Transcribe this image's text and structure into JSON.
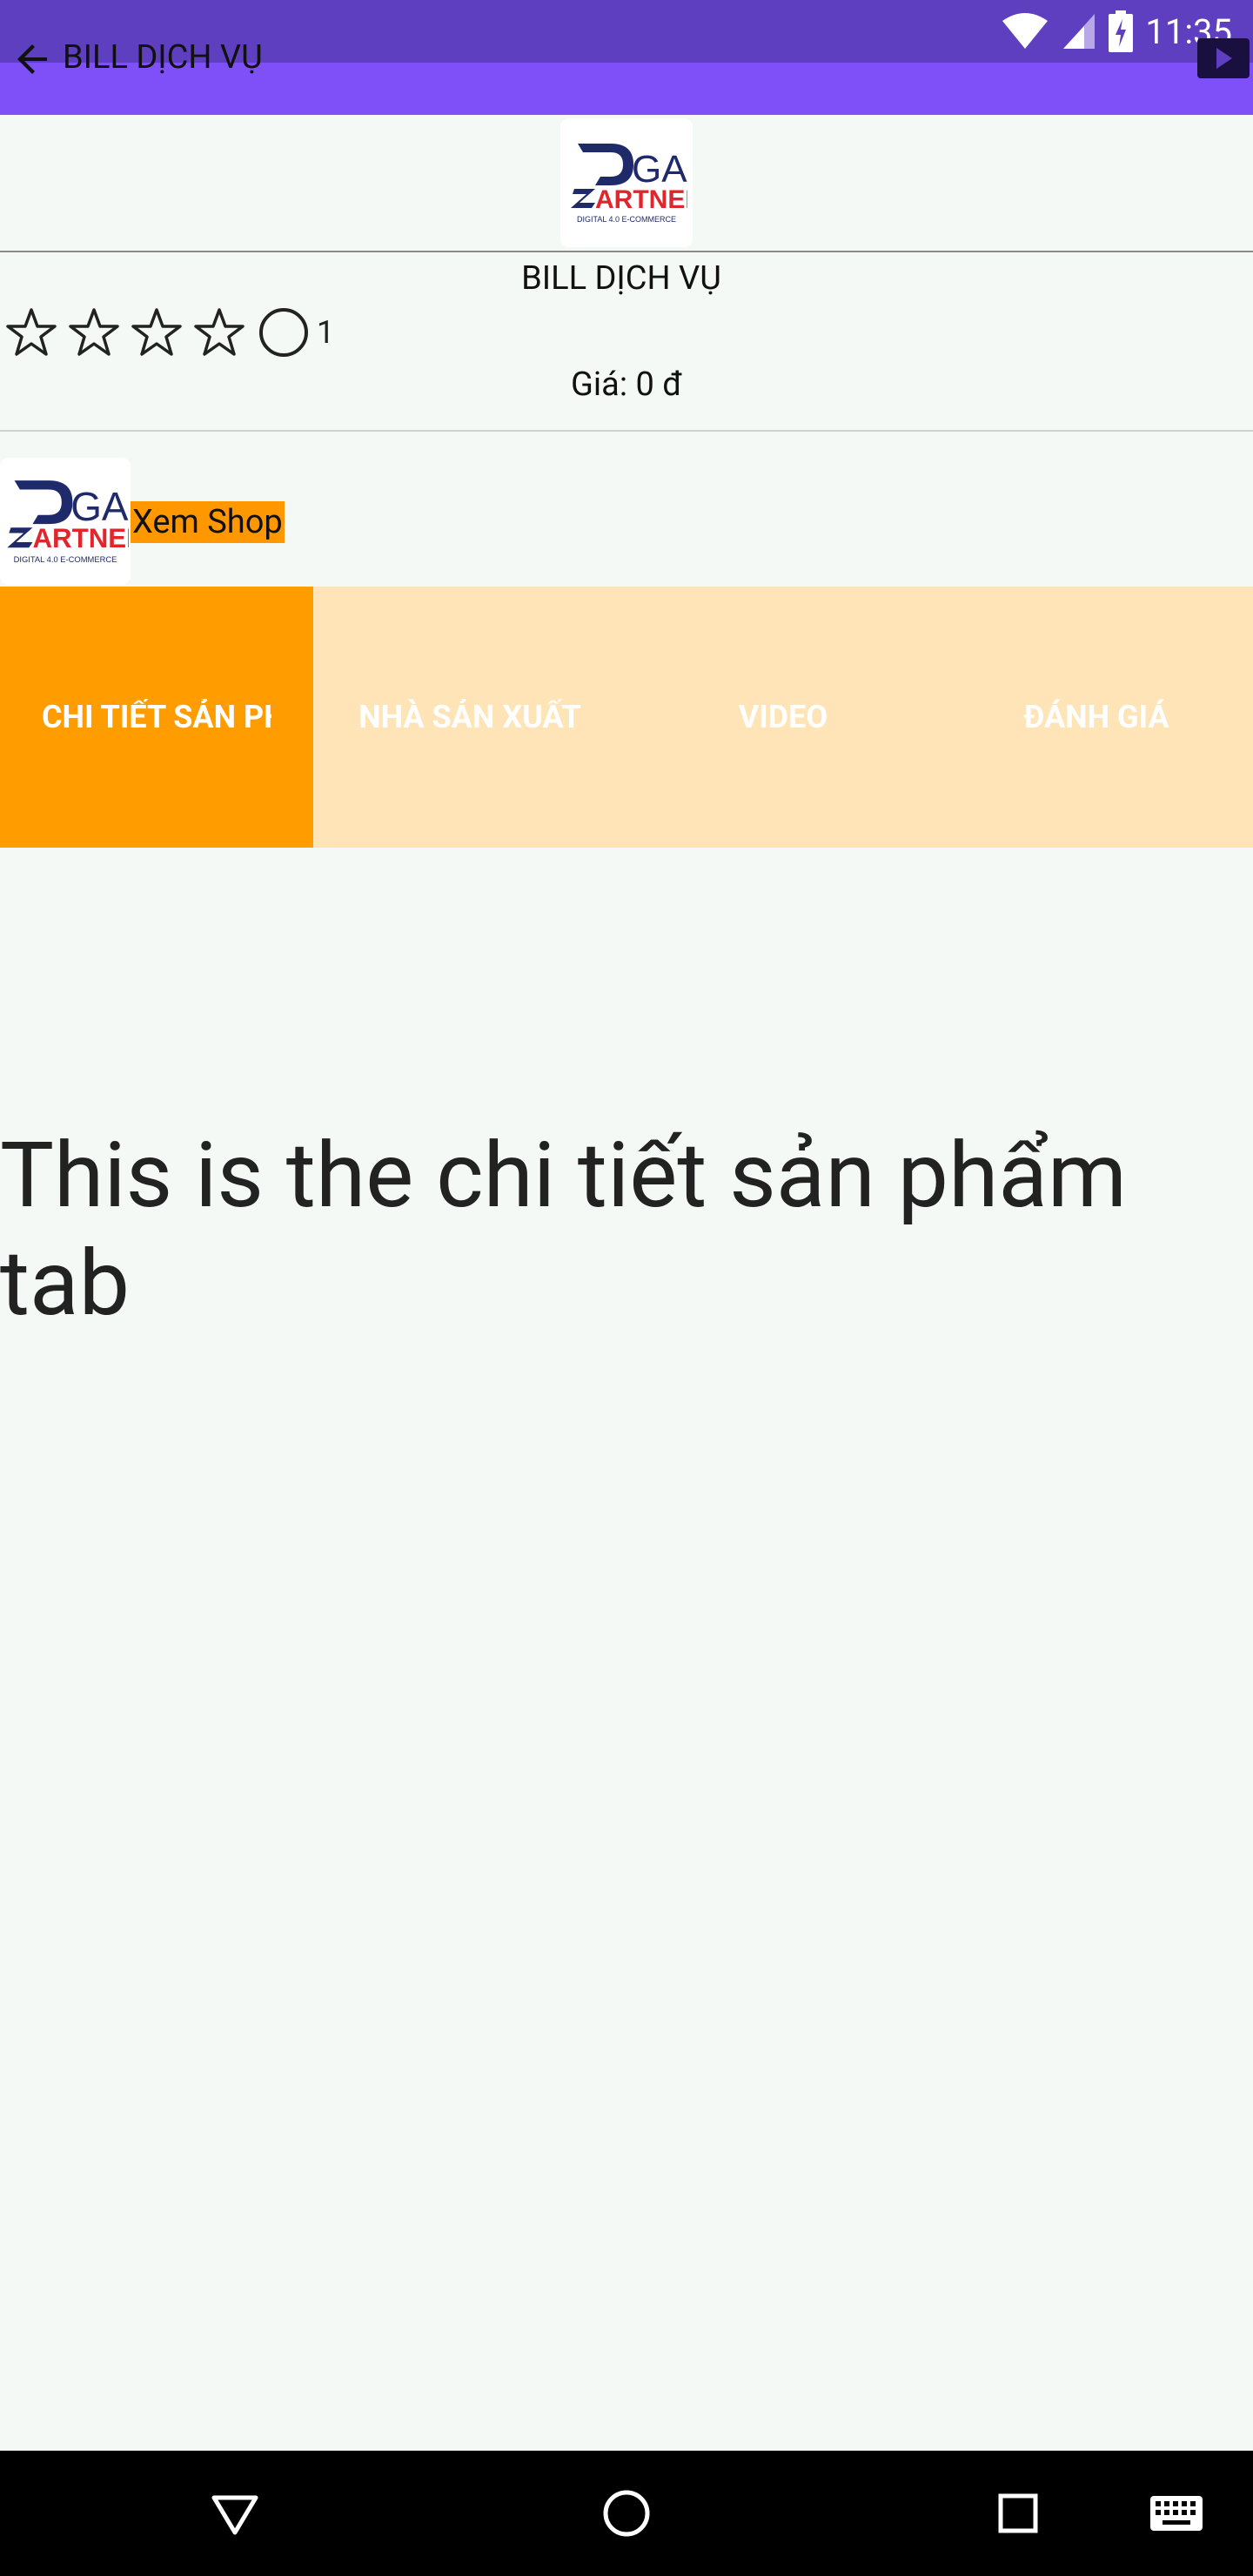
{
  "status_bar": {
    "time": "11:35"
  },
  "app_bar": {
    "title": "BILL DỊCH VỤ"
  },
  "logo": {
    "line1": "GA",
    "line2": "ARTNER",
    "tagline": "DIGITAL 4.0 E-COMMERCE"
  },
  "product": {
    "name": "BILL DỊCH VỤ",
    "rating_count": "1",
    "price": "Giá: 0  đ"
  },
  "shop": {
    "view_label": "Xem Shop"
  },
  "tabs": [
    {
      "label": "CHI TIẾT SẢN PHẨM",
      "active": true
    },
    {
      "label": "NHÀ SẢN XUẤT",
      "active": false
    },
    {
      "label": "VIDEO",
      "active": false
    },
    {
      "label": "ĐÁNH GIÁ",
      "active": false
    }
  ],
  "content": {
    "text": "This is the chi tiết sản phẩm tab"
  },
  "colors": {
    "status_bar": "#5e3fbf",
    "app_bar": "#7f4ff7",
    "accent": "#ff9800",
    "tab_bg": "#ffe4b8"
  }
}
